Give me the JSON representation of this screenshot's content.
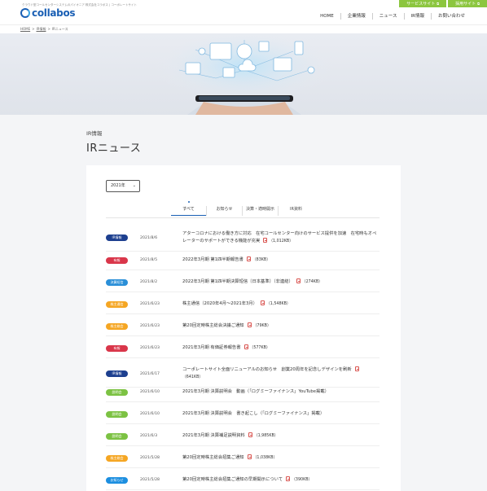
{
  "header": {
    "tagline": "クラウド型コールセンターシステムのパイオニア 株式会社コラボス | コーポレートサイト",
    "logo_text": "collabos",
    "top_buttons": [
      "サービスサイト",
      "採用サイト"
    ],
    "nav": [
      "HOME",
      "企業情報",
      "ニュース",
      "IR情報",
      "お問い合わせ"
    ]
  },
  "breadcrumb": [
    "HOME",
    "IR情報",
    "IRニュース"
  ],
  "page": {
    "subtitle": "IR情報",
    "title": "IRニュース"
  },
  "filter": {
    "year": "2021年"
  },
  "tabs": [
    "すべて",
    "お知らせ",
    "決算・適時開示",
    "IR資料"
  ],
  "colors": {
    "brand": "#1a5fb4",
    "green": "#8cc63f",
    "ir_badge": "#1d3f8f",
    "yuho": "#d9364a",
    "kessan": "#2a8fd8",
    "kabu": "#f5a623",
    "setsumei": "#7cc243",
    "oshirase": "#1d8fe0"
  },
  "news": [
    {
      "badge": "IR情報",
      "color": "#1d3f8f",
      "date": "2021/8/6",
      "text": "アターコロナにおける働き方に対応　在宅コールセンター向けのサービス提供を加速　在宅時もオペレーターのサポートができる機能が充実",
      "size": "（1,012KB）"
    },
    {
      "badge": "有報",
      "color": "#d9364a",
      "date": "2021/8/5",
      "text": "2022年3月期 第1四半期報告書",
      "size": "（83KB）"
    },
    {
      "badge": "決算短信",
      "color": "#2a8fd8",
      "date": "2021/8/2",
      "text": "2022年3月期 第1四半期決算短信〔日本基準〕（非連結）",
      "size": "（274KB）"
    },
    {
      "badge": "株主通信",
      "color": "#f5a623",
      "date": "2021/6/23",
      "text": "株主通信（2020年4月～2021年3月）",
      "size": "（1,548KB）"
    },
    {
      "badge": "株主総会",
      "color": "#f5a623",
      "date": "2021/6/23",
      "text": "第20回定時株主総会決議ご通知",
      "size": "（79KB）"
    },
    {
      "badge": "有報",
      "color": "#d9364a",
      "date": "2021/6/23",
      "text": "2021年3月期 有価証券報告書",
      "size": "（577KB）"
    },
    {
      "badge": "IR情報",
      "color": "#1d3f8f",
      "date": "2021/6/17",
      "text": "コーポレートサイト全面リニューアルのお知らせ　創業20周年を記念しデザインを刷新",
      "size": "（641KB）"
    },
    {
      "badge": "説明会",
      "color": "#7cc243",
      "date": "2021/6/10",
      "text": "2021年3月期 決算説明会　動画（「ログミーファイナンス」YouTube掲載）",
      "size": ""
    },
    {
      "badge": "説明会",
      "color": "#7cc243",
      "date": "2021/6/10",
      "text": "2021年3月期 決算説明会　書き起こし（「ログミーファイナンス」掲載）",
      "size": ""
    },
    {
      "badge": "説明会",
      "color": "#7cc243",
      "date": "2021/6/3",
      "text": "2021年3月期 決算補足説明資料",
      "size": "（1,985KB）"
    },
    {
      "badge": "株主総会",
      "color": "#f5a623",
      "date": "2021/5/28",
      "text": "第20回定時株主総会招集ご通知",
      "size": "（1,038KB）"
    },
    {
      "badge": "お知らせ",
      "color": "#1d8fe0",
      "date": "2021/5/28",
      "text": "第20回定時株主総会招集ご通知の早期開示について",
      "size": "（390KB）"
    }
  ]
}
